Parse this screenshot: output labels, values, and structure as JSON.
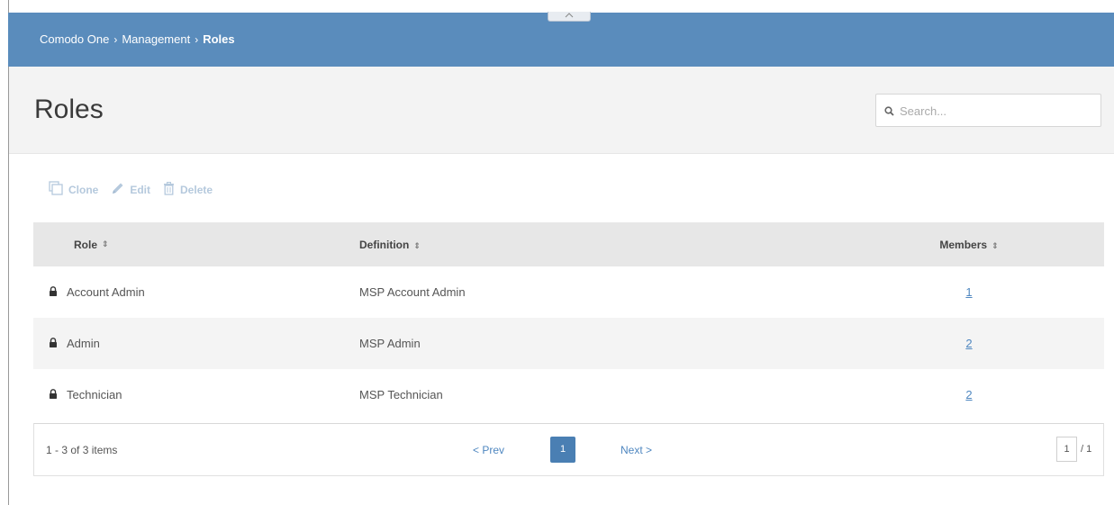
{
  "breadcrumb": {
    "items": [
      "Comodo One",
      "Management"
    ],
    "current": "Roles",
    "separator": "›"
  },
  "collapse_tab": {
    "icon": "chevron-up-icon",
    "glyph": "⌃"
  },
  "page": {
    "title": "Roles"
  },
  "search": {
    "placeholder": "Search...",
    "value": ""
  },
  "toolbar": {
    "clone_label": "Clone",
    "edit_label": "Edit",
    "delete_label": "Delete"
  },
  "grid": {
    "columns": {
      "role": "Role",
      "definition": "Definition",
      "members": "Members"
    },
    "sort_glyph": "⇕",
    "rows": [
      {
        "role": "Account Admin",
        "definition": "MSP Account Admin",
        "members": "1"
      },
      {
        "role": "Admin",
        "definition": "MSP Admin",
        "members": "2"
      },
      {
        "role": "Technician",
        "definition": "MSP Technician",
        "members": "2"
      }
    ]
  },
  "pager": {
    "summary": "1 - 3 of 3 items",
    "prev_label": "< Prev",
    "current_page": "1",
    "next_label": "Next >",
    "page_input": "1",
    "total_pages": "/ 1"
  },
  "colors": {
    "topbar": "#5a8cbc",
    "accent": "#4a7fb3",
    "link": "#4f87c0",
    "toolbar_disabled": "#b5c9dd"
  }
}
